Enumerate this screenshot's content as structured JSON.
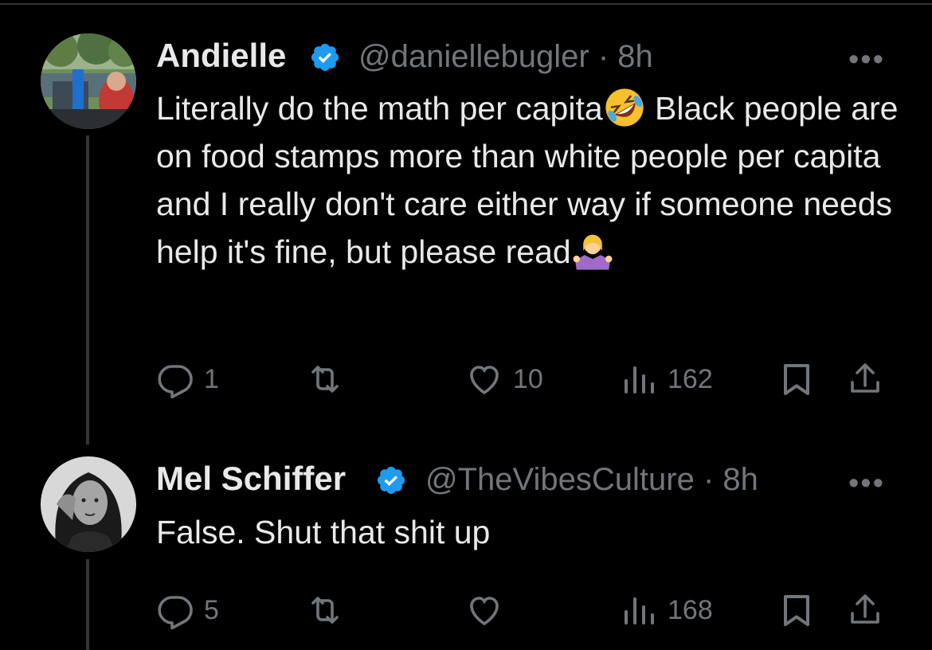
{
  "tweets": [
    {
      "display_name": "Andielle",
      "handle": "@daniellebugler",
      "sep": "·",
      "time": "8h",
      "more": "•••",
      "text_before": "Literally do the math per capita",
      "text_middle": " Black people are on food stamps more than white people per capita and I really don't care either way if someone needs help it's fine, but please read",
      "replies": "1",
      "retweets": "",
      "likes": "10",
      "views": "162"
    },
    {
      "display_name": "Mel Schiffer",
      "handle": "@TheVibesCulture",
      "sep": "·",
      "time": "8h",
      "more": "•••",
      "text": "False. Shut that shit up",
      "replies": "5",
      "retweets": "",
      "likes": "",
      "views": "168"
    }
  ],
  "icons": {
    "verified_color": "#1d9bf0",
    "action_color": "#71767b",
    "emoji_1": "rolling-on-floor-laughing",
    "emoji_2": "person-shrugging"
  }
}
